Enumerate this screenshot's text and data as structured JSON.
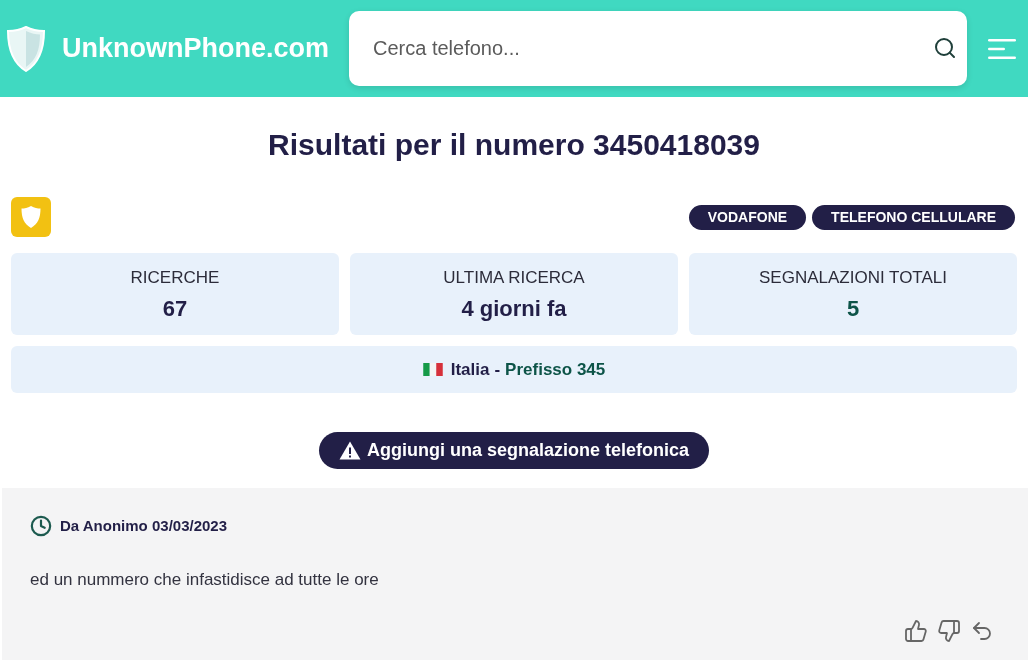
{
  "header": {
    "logo_text": "UnknownPhone.com",
    "search": {
      "placeholder": "Cerca telefono..."
    }
  },
  "title": "Risultati per il numero 3450418039",
  "tags": [
    "VODAFONE",
    "TELEFONO CELLULARE"
  ],
  "stats": [
    {
      "label": "RICERCHE",
      "value": "67",
      "color": "#221f47"
    },
    {
      "label": "ULTIMA RICERCA",
      "value": "4 giorni fa",
      "color": "#221f47"
    },
    {
      "label": "SEGNALAZIONI TOTALI",
      "value": "5",
      "color": "#0d5448"
    }
  ],
  "location": {
    "country": "Italia",
    "separator": "-",
    "prefix": "Prefisso 345"
  },
  "report_button": "Aggiungi una segnalazione telefonica",
  "comments": [
    {
      "author_line": "Da Anonimo 03/03/2023",
      "text": "ed un nummero che infastidisce ad tutte le ore"
    }
  ]
}
